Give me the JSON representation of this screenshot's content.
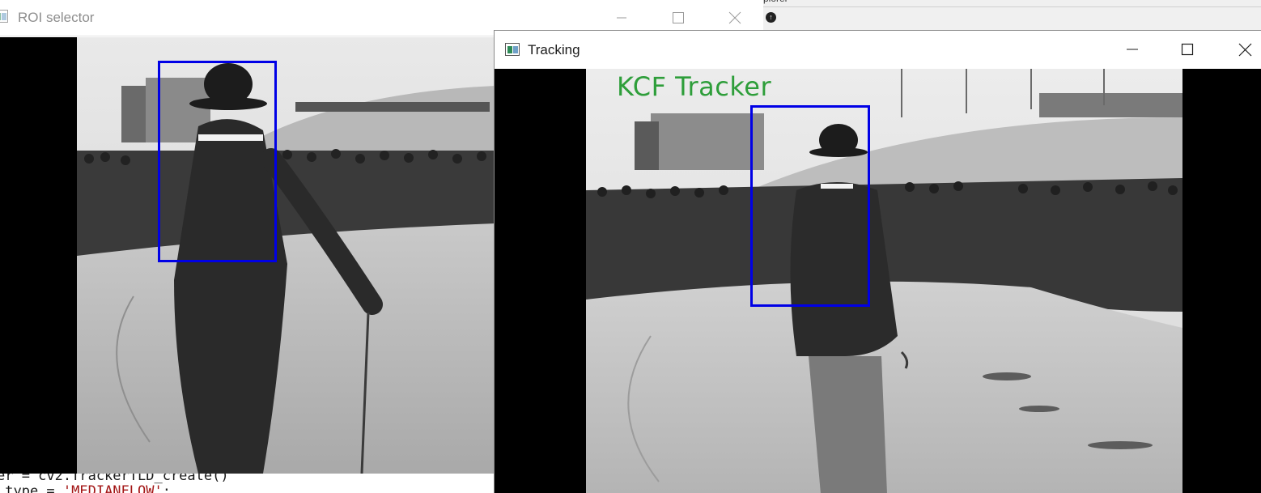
{
  "background_app": {
    "title_fragment": "plorer",
    "nav_icon": "arrow-up-circle-icon"
  },
  "code_editor": {
    "line1": "er = cv2.TrackerTLD_create()",
    "line2_prefix": " type = ",
    "line2_string": "'MEDIANFLOW'",
    "line2_suffix": ";"
  },
  "roi_window": {
    "title": "ROI selector",
    "state": "inactive",
    "controls": [
      "minimize-icon",
      "maximize-icon",
      "close-icon"
    ]
  },
  "tracking_window": {
    "title": "Tracking",
    "state": "active",
    "controls": [
      "minimize-icon",
      "maximize-icon",
      "close-icon"
    ],
    "overlay_text": "KCF Tracker"
  },
  "colors": {
    "bbox": "#0000e6",
    "overlay_text": "#2e9e3a",
    "letterbox": "#000000"
  }
}
